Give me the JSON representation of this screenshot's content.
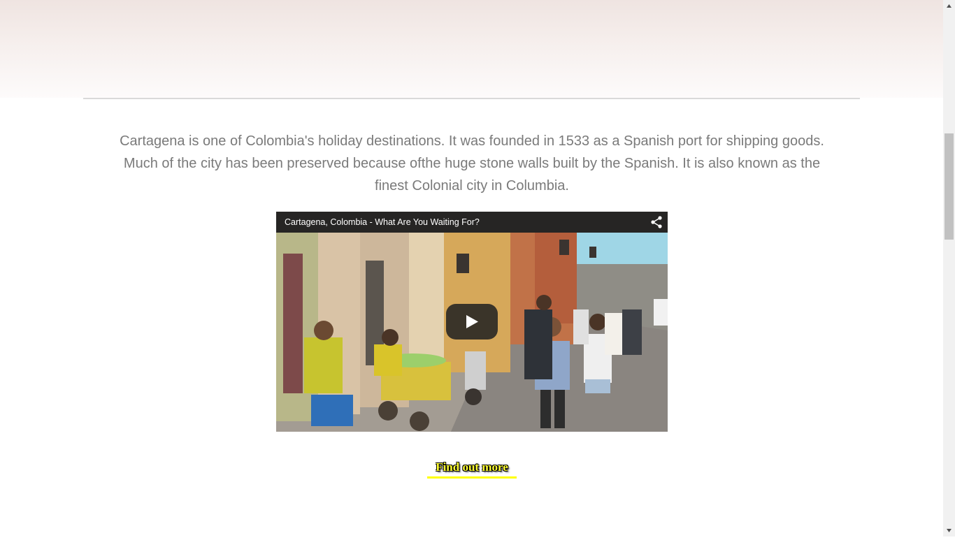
{
  "intro": {
    "text": "Cartagena is one of Colombia's holiday destinations. It was founded in 1533 as a Spanish port for shipping goods. Much of the city has been preserved because ofthe huge stone walls built by the Spanish. It is also known as the finest Colonial city in Columbia."
  },
  "video": {
    "title": "Cartagena, Colombia - What Are You Waiting For?",
    "share_icon": "share-icon",
    "play_icon": "play-icon"
  },
  "cta": {
    "label": "Find out more"
  },
  "colors": {
    "body_text": "#7a7a7a",
    "cta_text": "#ffff33",
    "cta_underline": "#ffff00",
    "divider": "#d9d9d9"
  }
}
